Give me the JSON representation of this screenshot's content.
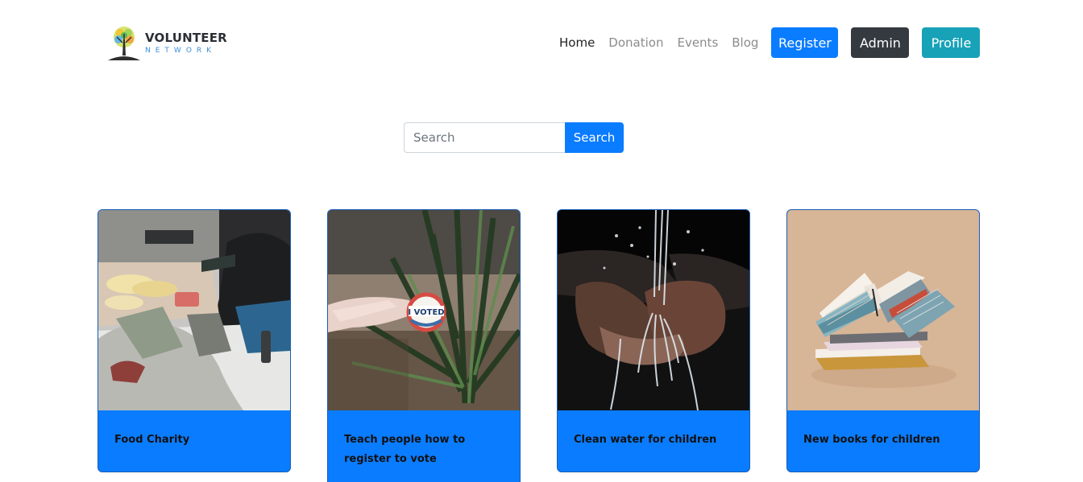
{
  "brand": {
    "title": "VOLUNTEER",
    "subtitle": "NETWORK"
  },
  "nav": {
    "home": "Home",
    "donation": "Donation",
    "events": "Events",
    "blog": "Blog",
    "register": "Register",
    "admin": "Admin",
    "profile": "Profile"
  },
  "search": {
    "placeholder": "Search",
    "button": "Search"
  },
  "cards": [
    {
      "title": "Food Charity"
    },
    {
      "title": "Teach people how to register to vote"
    },
    {
      "title": "Clean water for children"
    },
    {
      "title": "New books for children"
    }
  ],
  "colors": {
    "primary": "#0a7cff",
    "dark": "#343a40",
    "info": "#17a2b8"
  }
}
